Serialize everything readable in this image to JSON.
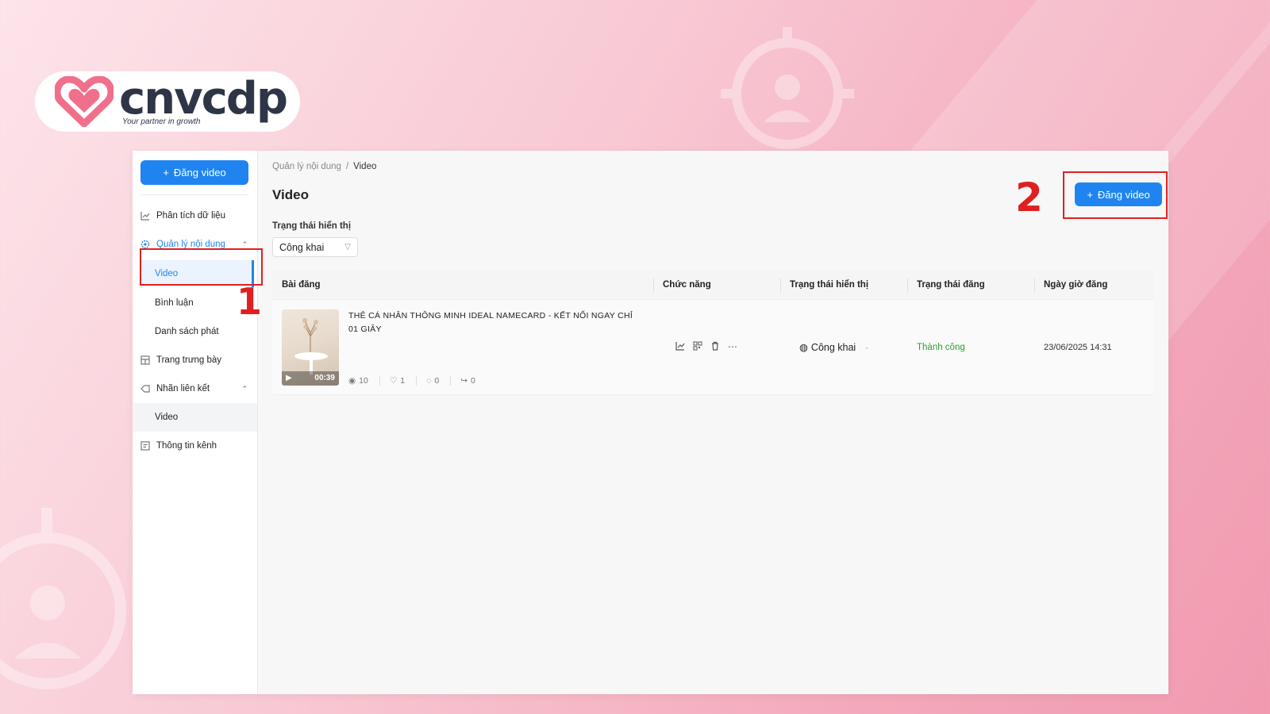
{
  "brand": {
    "name": "cnvcdp",
    "tagline": "Your partner in growth",
    "colors": {
      "heart": "#f0708c",
      "word": "#2e3547",
      "accent": "#1f84f0",
      "annotation": "#e02020"
    }
  },
  "sidebar": {
    "upload_button": "Đăng video",
    "items": [
      {
        "label": "Phân tích dữ liệu",
        "icon": "chart-line-icon"
      },
      {
        "label": "Quản lý nội dung",
        "icon": "settings-icon",
        "expanded": true,
        "children": [
          {
            "label": "Video",
            "selected": true
          },
          {
            "label": "Bình luận"
          },
          {
            "label": "Danh sách phát"
          }
        ]
      },
      {
        "label": "Trang trưng bày",
        "icon": "showcase-icon"
      },
      {
        "label": "Nhãn liên kết",
        "icon": "tag-icon",
        "expanded": true,
        "children": [
          {
            "label": "Video"
          }
        ]
      },
      {
        "label": "Thông tin kênh",
        "icon": "info-card-icon"
      }
    ]
  },
  "breadcrumb": {
    "parent": "Quản lý nội dung",
    "separator": "/",
    "current": "Video"
  },
  "page": {
    "title": "Video",
    "upload_button": "Đăng video"
  },
  "filter": {
    "label": "Trạng thái hiển thị",
    "value": "Công khai"
  },
  "table": {
    "columns": [
      "Bài đăng",
      "Chức năng",
      "Trạng thái hiển thị",
      "Trạng thái đăng",
      "Ngày giờ đăng"
    ],
    "rows": [
      {
        "title": "THẺ CÁ NHÂN THÔNG MINH IDEAL NAMECARD - KẾT NỐI NGAY CHỈ 01 GIÂY",
        "duration": "00:39",
        "views": "10",
        "likes": "1",
        "comments": "0",
        "shares": "0",
        "visibility": "Công khai",
        "status": "Thành công",
        "datetime": "23/06/2025 14:31"
      }
    ]
  },
  "annotations": {
    "first": "1",
    "second": "2"
  }
}
